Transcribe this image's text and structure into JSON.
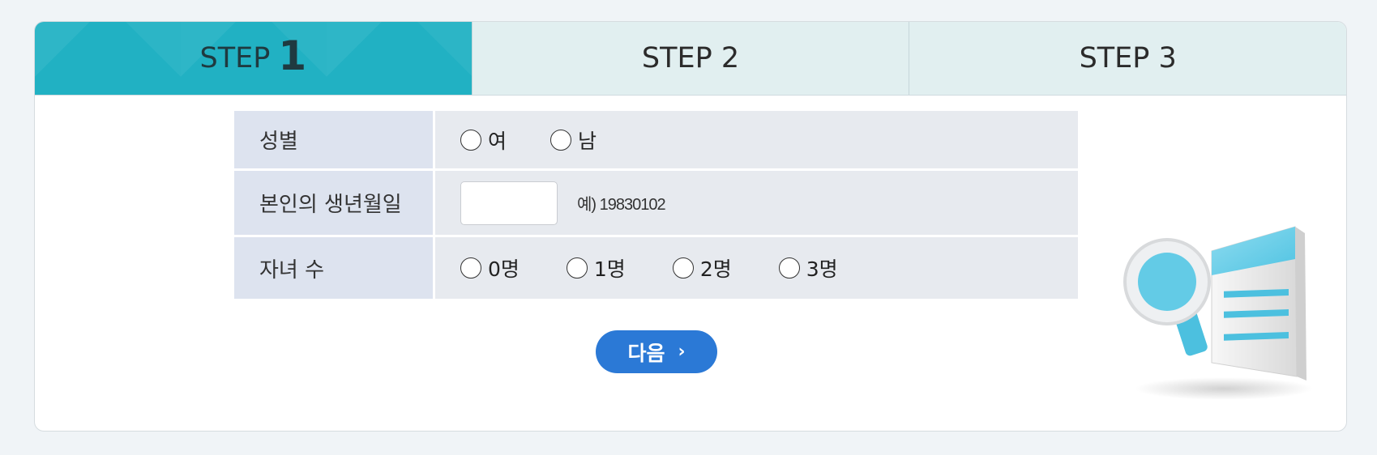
{
  "steps": [
    {
      "prefix": "STEP",
      "num": "1",
      "active": true
    },
    {
      "label": "STEP 2",
      "active": false
    },
    {
      "label": "STEP 3",
      "active": false
    }
  ],
  "form": {
    "gender": {
      "label": "성별",
      "options": [
        "여",
        "남"
      ]
    },
    "birth": {
      "label": "본인의 생년월일",
      "value": "",
      "hint": "예) 19830102"
    },
    "children": {
      "label": "자녀 수",
      "options": [
        "0명",
        "1명",
        "2명",
        "3명"
      ]
    }
  },
  "next_button": {
    "label": "다음",
    "icon": "chevron-right-icon"
  },
  "colors": {
    "active_step": "#21b1c3",
    "inactive_step": "#e1eff0",
    "button": "#2b79d6",
    "label_bg": "#dde3ef",
    "value_bg": "#e7eaef"
  },
  "illustration": {
    "icon": "document-magnifier-icon"
  }
}
